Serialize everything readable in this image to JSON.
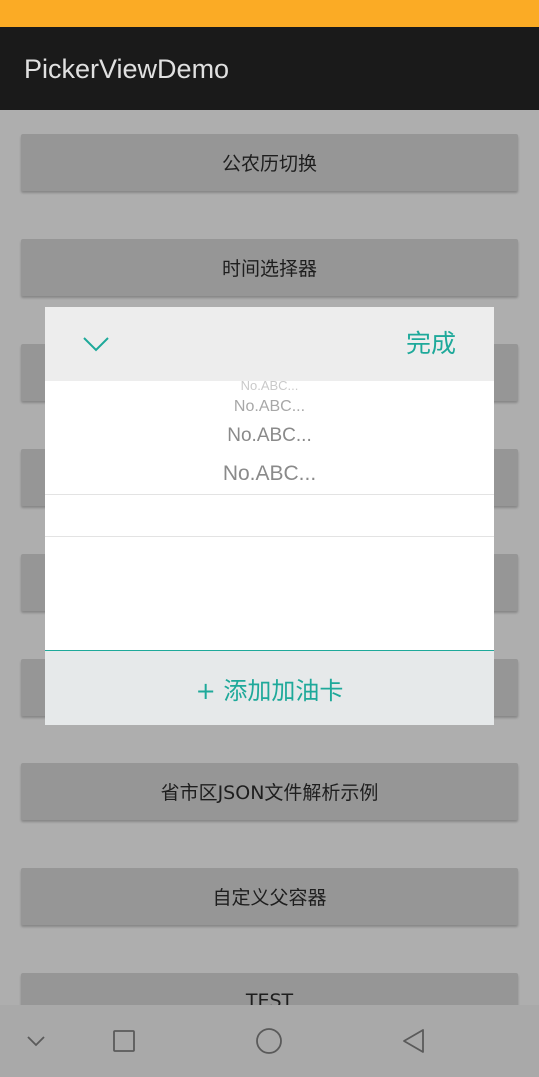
{
  "app": {
    "title": "PickerViewDemo"
  },
  "buttons": [
    "公农历切换",
    "时间选择器",
    "",
    "",
    "",
    "",
    "省市区JSON文件解析示例",
    "自定义父容器",
    "TEST"
  ],
  "picker": {
    "done_label": "完成",
    "options": [
      "No.ABC...",
      "No.ABC...",
      "No.ABC...",
      "No.ABC..."
    ],
    "add_card_label": "+ 添加加油卡"
  },
  "icons": {
    "collapse": "chevron-down-icon",
    "nav_hide": "chevron-down-icon",
    "nav_recent": "square-icon",
    "nav_home": "circle-icon",
    "nav_back": "triangle-back-icon"
  },
  "colors": {
    "status_bar": "#fbab25",
    "app_bar": "#1a1a1a",
    "accent": "#1ea99a"
  }
}
